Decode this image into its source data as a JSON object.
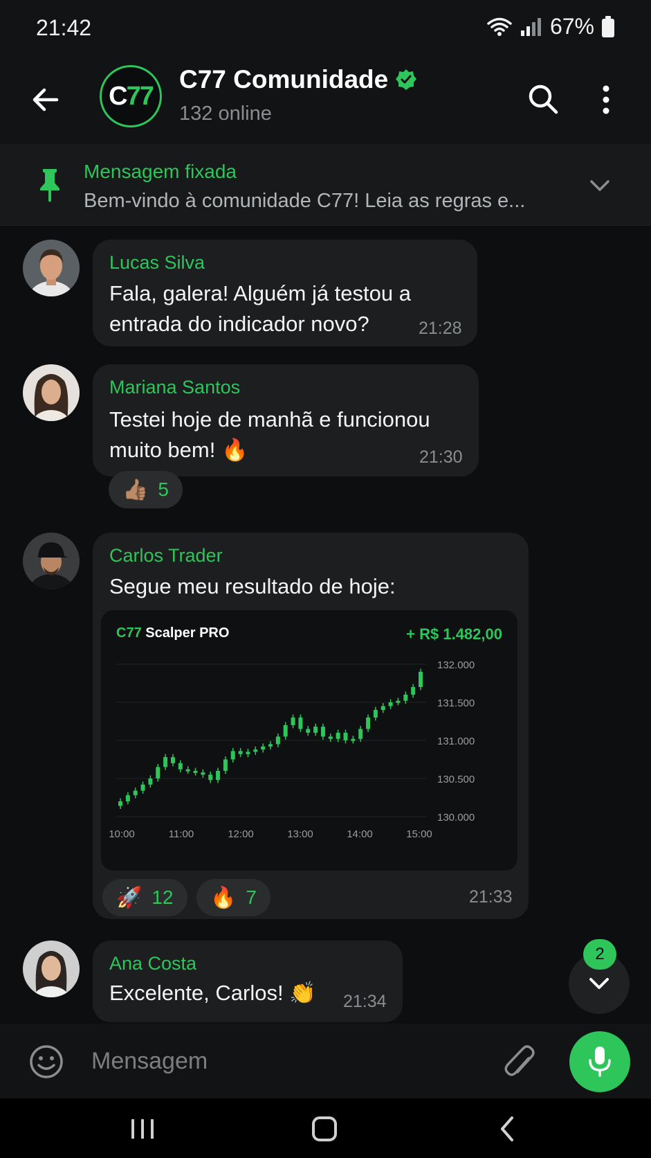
{
  "status": {
    "time": "21:42",
    "battery": "67%"
  },
  "header": {
    "avatar_letters": "C",
    "avatar_digits": "77",
    "title": "C77 Comunidade",
    "subtitle": "132 online"
  },
  "pinned": {
    "title": "Mensagem fixada",
    "text": "Bem-vindo à comunidade C77! Leia as regras e..."
  },
  "messages": [
    {
      "sender": "Lucas Silva",
      "lines": [
        "Fala, galera! Alguém já testou a",
        "entrada do indicador novo?"
      ],
      "time": "21:28"
    },
    {
      "sender": "Mariana Santos",
      "lines": [
        "Testei hoje de manhã e funcionou",
        "muito bem! 🔥"
      ],
      "time": "21:30",
      "reactions": [
        {
          "emoji": "👍🏽",
          "count": "5"
        }
      ]
    },
    {
      "sender": "Carlos Trader",
      "lines": [
        "Segue meu resultado de hoje:"
      ],
      "time": "21:33",
      "card": {
        "brand_a": "C77",
        "brand_b": "Scalper PRO",
        "profit": "+ R$ 1.482,00"
      },
      "reactions": [
        {
          "emoji": "🚀",
          "count": "12"
        },
        {
          "emoji": "🔥",
          "count": "7"
        }
      ]
    },
    {
      "sender": "Ana Costa",
      "lines": [
        "Excelente, Carlos! 👏"
      ],
      "time": "21:34"
    }
  ],
  "chart_data": {
    "type": "candlestick",
    "x_ticks": [
      "10:00",
      "11:00",
      "12:00",
      "13:00",
      "14:00",
      "15:00"
    ],
    "y_ticks": [
      "132.000",
      "131.500",
      "131.000",
      "130.500",
      "130.000"
    ],
    "ylim": [
      130000,
      132000
    ],
    "close_values": [
      130200,
      130280,
      130340,
      130420,
      130500,
      130650,
      130780,
      130700,
      130620,
      130600,
      130580,
      130550,
      130480,
      130600,
      130750,
      130860,
      130820,
      130850,
      130880,
      130920,
      130950,
      131050,
      131200,
      131300,
      131150,
      131100,
      131180,
      131050,
      131020,
      131100,
      131000,
      131020,
      131150,
      131300,
      131400,
      131450,
      131500,
      131520,
      131600,
      131700,
      131900
    ],
    "color": "#2ec55a"
  },
  "scroll": {
    "unread": "2"
  },
  "input": {
    "placeholder": "Mensagem"
  }
}
